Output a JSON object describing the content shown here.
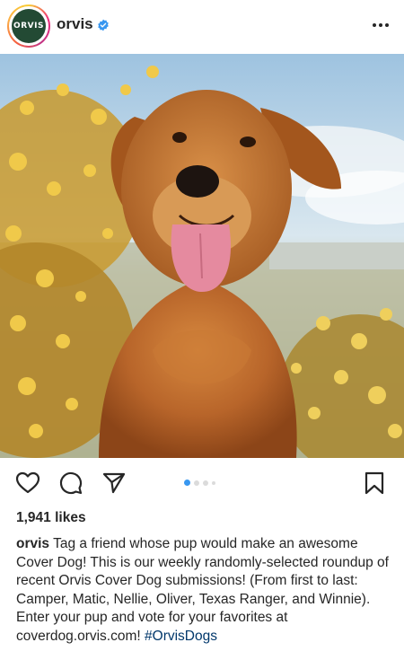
{
  "header": {
    "avatar_text": "ORVIS",
    "username": "orvis",
    "verified_icon": "verified-badge-icon",
    "more_icon": "more-options-icon"
  },
  "post": {
    "image_description_icon": "dog-photo",
    "carousel": {
      "count": 4,
      "active_index": 0
    },
    "likes": "1,941 likes",
    "caption_user": "orvis",
    "caption_text": "Tag a friend whose pup would make an awesome Cover Dog! This is our weekly randomly-selected roundup of recent Orvis Cover Dog submissions! (From first to last: Camper, Matic, Nellie, Oliver, Texas Ranger, and Winnie). Enter your pup and vote for your favorites at coverdog.orvis.com!",
    "hashtag": "#OrvisDogs"
  },
  "actions": {
    "like_icon": "heart-icon",
    "comment_icon": "comment-icon",
    "share_icon": "send-icon",
    "save_icon": "bookmark-icon"
  },
  "colors": {
    "accent": "#3897f0",
    "avatar_bg": "#234a34",
    "text": "#262626",
    "hashtag": "#00376b"
  }
}
